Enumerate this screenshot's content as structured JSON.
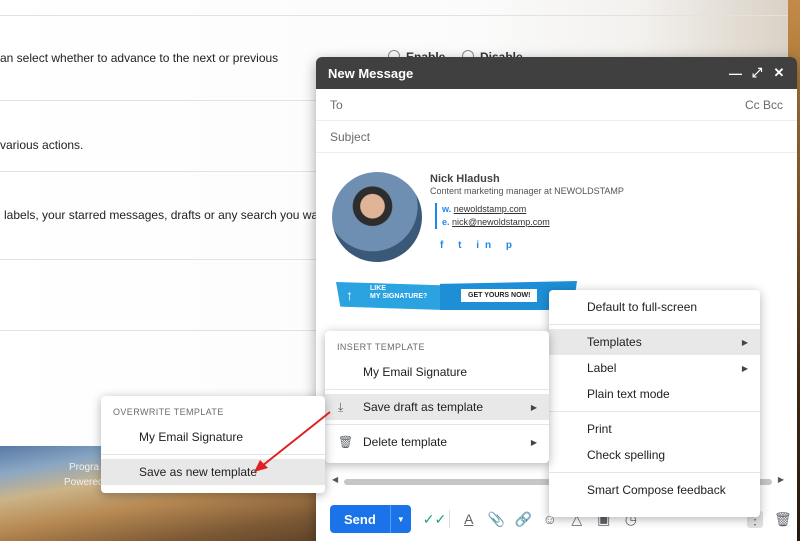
{
  "background": {
    "rows": [
      "an select whether to advance to the next or previous",
      "various actions.",
      "labels, your starred messages, drafts or any search you want,"
    ],
    "radio_enable": "Enable",
    "radio_disable": "Disable",
    "footer_line1": "Progra",
    "footer_line2": "Powered"
  },
  "compose": {
    "title": "New Message",
    "to_label": "To",
    "cc_bcc": "Cc Bcc",
    "subject_placeholder": "Subject",
    "signature": {
      "name": "Nick Hladush",
      "role": "Content marketing manager at NEWOLDSTAMP",
      "website_prefix": "w.",
      "website": "newoldstamp.com",
      "email_prefix": "e.",
      "email": "nick@newoldstamp.com",
      "social": [
        "f",
        "t",
        "in",
        "p"
      ],
      "banner_like": "LIKE",
      "banner_sig": "MY SIGNATURE?",
      "banner_cta": "GET YOURS NOW!"
    },
    "send_label": "Send"
  },
  "menus": {
    "more_options": {
      "items": [
        "Default to full-screen",
        "Templates",
        "Label",
        "Plain text mode",
        "Print",
        "Check spelling",
        "Smart Compose feedback"
      ]
    },
    "insert_template": {
      "header": "INSERT TEMPLATE",
      "template_item": "My Email Signature",
      "save_draft": "Save draft as template",
      "delete_template": "Delete template"
    },
    "overwrite_template": {
      "header": "OVERWRITE TEMPLATE",
      "template_item": "My Email Signature",
      "save_new": "Save as new template"
    }
  },
  "colors": {
    "header_bg": "#404040",
    "send_blue": "#1a73e8",
    "annotation_red": "#e02020",
    "highlight": "#e8e8e8"
  },
  "icons": {
    "minimize": "minimize-icon",
    "fullscreen": "expand-icon",
    "close": "close-icon",
    "formatting": "text-format-icon",
    "attach": "paperclip-icon",
    "link": "link-icon",
    "emoji": "emoji-icon",
    "drive": "drive-icon",
    "photo": "photo-icon",
    "confidential": "lock-clock-icon",
    "more": "more-vert-icon",
    "trash": "trash-icon"
  }
}
